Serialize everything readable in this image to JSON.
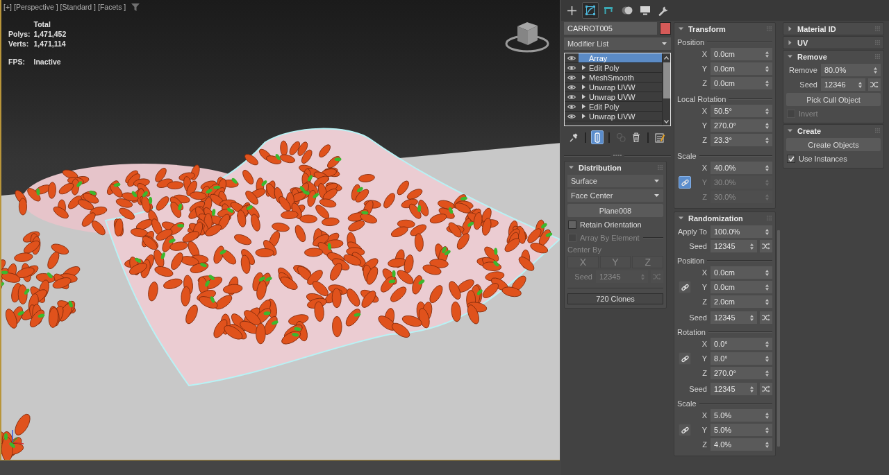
{
  "viewport": {
    "active": true,
    "menus": [
      "[+]",
      "[Perspective ]",
      "[Standard ]",
      "[Facets ]"
    ],
    "stats": {
      "header": "Total",
      "rows": [
        {
          "label": "Polys:",
          "value": "1,471,452"
        },
        {
          "label": "Verts:",
          "value": "1,471,114"
        }
      ],
      "fps": {
        "label": "FPS:",
        "value": "Inactive"
      }
    }
  },
  "command_tabs": [
    {
      "kind": "create",
      "selected": false
    },
    {
      "kind": "modify",
      "selected": true
    },
    {
      "kind": "hierarchy",
      "selected": false
    },
    {
      "kind": "motion",
      "selected": false
    },
    {
      "kind": "display",
      "selected": false
    },
    {
      "kind": "utilities",
      "selected": false
    }
  ],
  "object_name": "CARROT005",
  "modifier_list": "Modifier List",
  "modifier_stack": [
    {
      "label": "Array",
      "selected": true,
      "expandable": false
    },
    {
      "label": "Edit Poly",
      "selected": false,
      "expandable": true
    },
    {
      "label": "MeshSmooth",
      "selected": false,
      "expandable": true
    },
    {
      "label": "Unwrap UVW",
      "selected": false,
      "expandable": true
    },
    {
      "label": "Unwrap UVW",
      "selected": false,
      "expandable": true
    },
    {
      "label": "Edit Poly",
      "selected": false,
      "expandable": true
    },
    {
      "label": "Unwrap UVW",
      "selected": false,
      "expandable": true
    }
  ],
  "stack_tools": [
    {
      "kind": "pin",
      "selected": false,
      "disabled": false
    },
    {
      "kind": "end-result",
      "selected": true,
      "disabled": false
    },
    {
      "kind": "make-unique",
      "selected": false,
      "disabled": true
    },
    {
      "kind": "remove",
      "selected": false,
      "disabled": false
    },
    {
      "kind": "configure",
      "selected": false,
      "disabled": false
    }
  ],
  "columns": [
    {
      "rollouts": [
        {
          "title": "Distribution",
          "expanded": true,
          "controls": [
            {
              "kind": "dropdown",
              "value": "Surface"
            },
            {
              "kind": "dropdown",
              "value": "Face Center"
            },
            {
              "kind": "button",
              "label": "Plane008",
              "disabled": false
            },
            {
              "kind": "checkbox",
              "label": "Retain Orientation",
              "checked": false,
              "disabled": false
            },
            {
              "kind": "checkbox",
              "label": "Array By Element",
              "checked": false,
              "disabled": true,
              "rule": true
            },
            {
              "kind": "label",
              "label": "Center By",
              "disabled": true
            },
            {
              "kind": "axis-buttons",
              "buttons": [
                "X",
                "Y",
                "Z"
              ],
              "disabled": true
            },
            {
              "kind": "spinner",
              "label": "Seed",
              "value": "12345",
              "disabled": true,
              "randomize": true
            },
            {
              "kind": "readout",
              "value": "720 Clones"
            }
          ]
        }
      ]
    },
    {
      "rollouts": [
        {
          "title": "Transform",
          "expanded": true,
          "controls": [
            {
              "kind": "vector",
              "label": "Position",
              "rows": [
                {
                  "axis": "X",
                  "value": "0.0cm",
                  "disabled": false
                },
                {
                  "axis": "Y",
                  "value": "0.0cm",
                  "disabled": false
                },
                {
                  "axis": "Z",
                  "value": "0.0cm",
                  "disabled": false
                }
              ]
            },
            {
              "kind": "vector",
              "label": "Local Rotation",
              "rows": [
                {
                  "axis": "X",
                  "value": "50.5°",
                  "disabled": false
                },
                {
                  "axis": "Y",
                  "value": "270.0°",
                  "disabled": false
                },
                {
                  "axis": "Z",
                  "value": "23.3°",
                  "disabled": false
                }
              ]
            },
            {
              "kind": "vector",
              "label": "Scale",
              "link": {
                "selected": true
              },
              "rows": [
                {
                  "axis": "X",
                  "value": "40.0%",
                  "disabled": false
                },
                {
                  "axis": "Y",
                  "value": "30.0%",
                  "disabled": true
                },
                {
                  "axis": "Z",
                  "value": "30.0%",
                  "disabled": true
                }
              ]
            }
          ]
        },
        {
          "title": "Randomization",
          "expanded": true,
          "controls": [
            {
              "kind": "spinner",
              "label": "Apply To",
              "value": "100.0%",
              "disabled": false,
              "randomize": false
            },
            {
              "kind": "spinner",
              "label": "Seed",
              "value": "12345",
              "disabled": false,
              "randomize": true
            },
            {
              "kind": "vector",
              "label": "Position",
              "link": {
                "selected": false
              },
              "rows": [
                {
                  "axis": "X",
                  "value": "0.0cm",
                  "disabled": false
                },
                {
                  "axis": "Y",
                  "value": "0.0cm",
                  "disabled": false
                },
                {
                  "axis": "Z",
                  "value": "2.0cm",
                  "disabled": false
                }
              ]
            },
            {
              "kind": "spinner",
              "label": "Seed",
              "value": "12345",
              "disabled": false,
              "randomize": true
            },
            {
              "kind": "vector",
              "label": "Rotation",
              "link": {
                "selected": false
              },
              "rows": [
                {
                  "axis": "X",
                  "value": "0.0°",
                  "disabled": false
                },
                {
                  "axis": "Y",
                  "value": "8.0°",
                  "disabled": false
                },
                {
                  "axis": "Z",
                  "value": "270.0°",
                  "disabled": false
                }
              ]
            },
            {
              "kind": "spinner",
              "label": "Seed",
              "value": "12345",
              "disabled": false,
              "randomize": true
            },
            {
              "kind": "vector",
              "label": "Scale",
              "link": {
                "selected": false
              },
              "rows": [
                {
                  "axis": "X",
                  "value": "5.0%",
                  "disabled": false
                },
                {
                  "axis": "Y",
                  "value": "5.0%",
                  "disabled": false
                },
                {
                  "axis": "Z",
                  "value": "4.0%",
                  "disabled": false
                }
              ]
            }
          ]
        }
      ]
    },
    {
      "rollouts": [
        {
          "title": "Material ID",
          "expanded": false
        },
        {
          "title": "UV",
          "expanded": false
        },
        {
          "title": "Remove",
          "expanded": true,
          "controls": [
            {
              "kind": "spinner",
              "label": "Remove",
              "value": "80.0%",
              "disabled": false,
              "randomize": false
            },
            {
              "kind": "spinner",
              "label": "Seed",
              "value": "12346",
              "disabled": false,
              "randomize": true
            },
            {
              "kind": "button",
              "label": "Pick Cull Object",
              "disabled": false
            },
            {
              "kind": "checkbox",
              "label": "Invert",
              "checked": false,
              "disabled": true
            }
          ]
        },
        {
          "title": "Create",
          "expanded": true,
          "controls": [
            {
              "kind": "button",
              "label": "Create Objects",
              "disabled": false
            },
            {
              "kind": "checkbox",
              "label": "Use Instances",
              "checked": true,
              "disabled": false
            }
          ]
        }
      ]
    }
  ]
}
